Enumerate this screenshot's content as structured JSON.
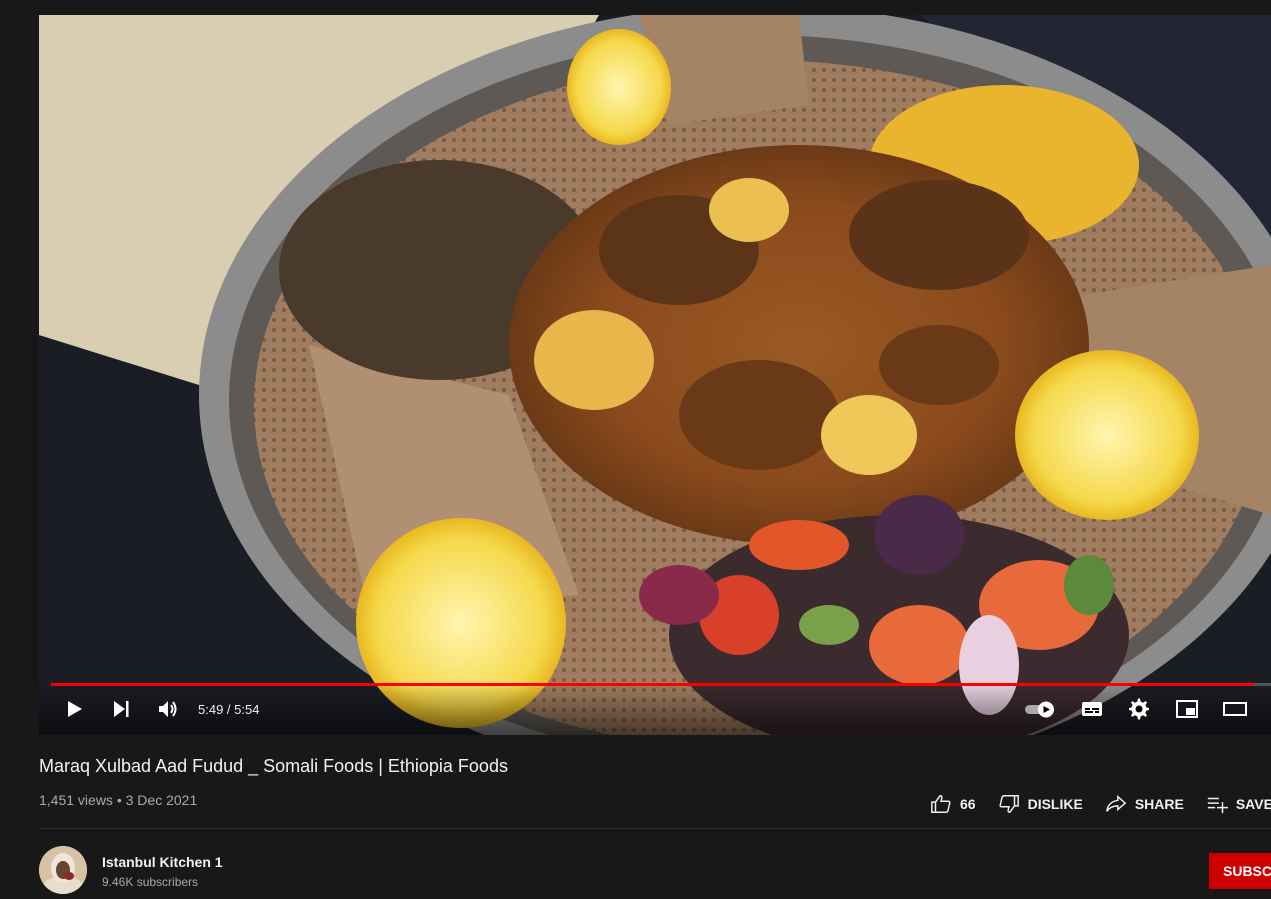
{
  "player": {
    "time_current": "5:49",
    "time_separator": " / ",
    "time_total": "5:54",
    "progress_percent": 98.6
  },
  "video": {
    "title": "Maraq Xulbad Aad Fudud _ Somali Foods | Ethiopia Foods",
    "views": "1,451 views",
    "date_separator": " • ",
    "date": "3 Dec 2021"
  },
  "actions": {
    "like_count": "66",
    "dislike_label": "DISLIKE",
    "share_label": "SHARE",
    "save_label": "SAVE"
  },
  "channel": {
    "name": "Istanbul Kitchen 1",
    "subscribers": "9.46K subscribers",
    "subscribe_label": "SUBSCRIBE"
  },
  "colors": {
    "accent": "#ff0000",
    "background": "#181818",
    "subscribe_bg": "#cc0000"
  }
}
